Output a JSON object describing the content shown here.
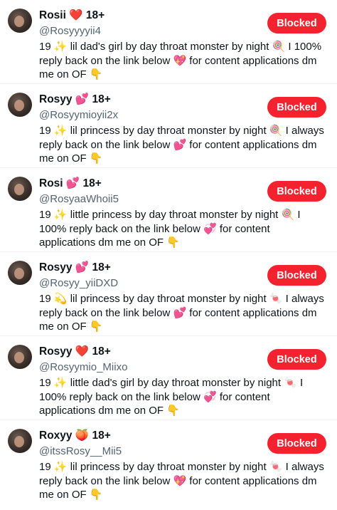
{
  "accounts": [
    {
      "name": "Rosii",
      "name_emoji": "❤️",
      "age_tag": "18+",
      "handle": "@Rosyyyyii4",
      "bio": "19 ✨ lil dad's girl by day throat monster by night 🍭 I 100% reply back on the link below 💖 for content applications dm me on OF 👇",
      "button": "Blocked"
    },
    {
      "name": "Rosyy",
      "name_emoji": "💕",
      "age_tag": "18+",
      "handle": "@Rosyymioyii2x",
      "bio": "19 ✨ lil princess by day throat monster by night 🍭 I always reply back on the link below 💕 for content applications dm me on OF 👇",
      "button": "Blocked"
    },
    {
      "name": "Rosi",
      "name_emoji": "💕",
      "age_tag": "18+",
      "handle": "@RosyaaWhoii5",
      "bio": "19 ✨ little princess by day throat monster by night 🍭 I 100% reply back on the link below 💞 for content applications dm me on OF 👇",
      "button": "Blocked"
    },
    {
      "name": "Rosyy",
      "name_emoji": "💕",
      "age_tag": "18+",
      "handle": "@Rosyy_yiiDXD",
      "bio": "19 💫 lil princess by day throat monster by night 🍬 I always reply back on the link below 💕 for content applications dm me on OF 👇",
      "button": "Blocked"
    },
    {
      "name": "Rosyy",
      "name_emoji": "❤️",
      "age_tag": "18+",
      "handle": "@Rosyymio_Miixo",
      "bio": "19 ✨ little dad's girl by day throat monster by night 🍬 I 100% reply back on the link below 💞 for content applications dm me on OF 👇",
      "button": "Blocked"
    },
    {
      "name": "Roxyy",
      "name_emoji": "🍑",
      "age_tag": "18+",
      "handle": "@itssRosy__Mii5",
      "bio": "19 ✨ lil princess by day throat monster by night 🍬 I always reply back on the link below 💖 for content applications dm me on OF 👇",
      "button": "Blocked"
    }
  ]
}
